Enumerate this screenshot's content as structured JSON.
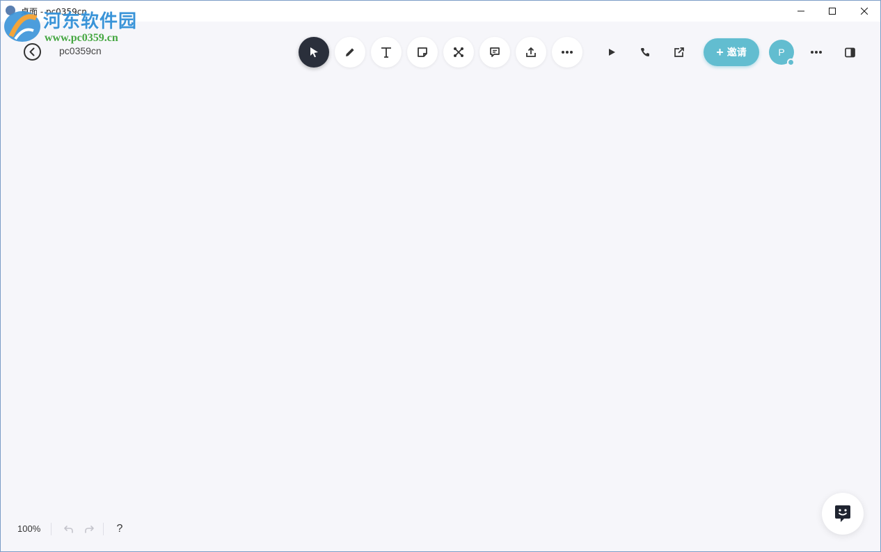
{
  "window": {
    "title": "桌面 - pc0359cn"
  },
  "watermark": {
    "title": "河东软件园",
    "url": "www.pc0359.cn"
  },
  "header": {
    "board_name": "pc0359cn",
    "tools": [
      {
        "name": "select",
        "icon": "cursor-icon",
        "active": true
      },
      {
        "name": "pen",
        "icon": "pencil-icon",
        "active": false
      },
      {
        "name": "text",
        "icon": "text-icon",
        "active": false
      },
      {
        "name": "sticky-note",
        "icon": "sticky-note-icon",
        "active": false
      },
      {
        "name": "mind-map",
        "icon": "network-icon",
        "active": false
      },
      {
        "name": "comment",
        "icon": "comment-icon",
        "active": false
      },
      {
        "name": "upload",
        "icon": "upload-icon",
        "active": false
      },
      {
        "name": "more",
        "icon": "more-icon",
        "active": false
      }
    ],
    "invite_label": "邀请",
    "invite_plus": "+",
    "avatar_initial": "P"
  },
  "footer": {
    "zoom": "100%",
    "help": "?"
  },
  "colors": {
    "background": "#f6f6fa",
    "accent": "#62bdd0",
    "active_tool": "#2a2f3b"
  }
}
